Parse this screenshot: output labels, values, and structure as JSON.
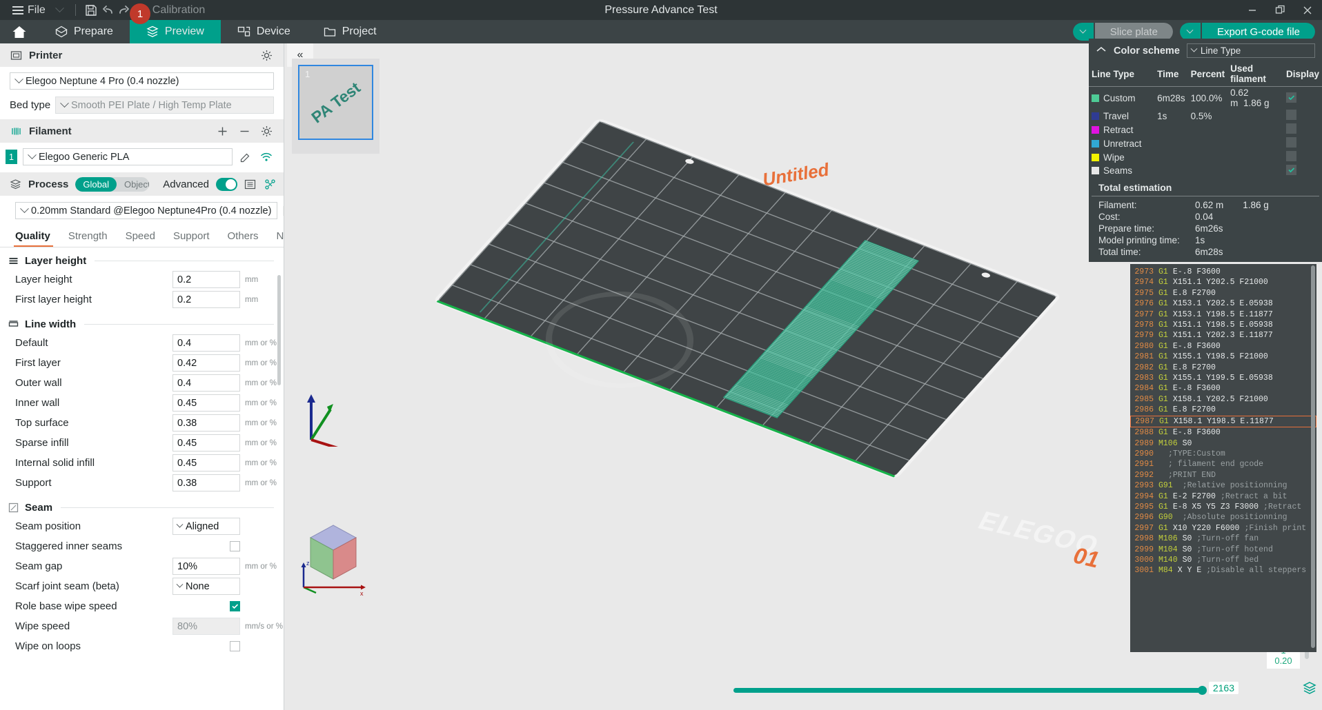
{
  "titlebar": {
    "file_label": "File",
    "calibration_label": "Calibration",
    "notification_count": "1",
    "app_title": "Pressure Advance Test",
    "icons": {
      "save": "save-icon",
      "undo": "undo-icon",
      "redo": "redo-icon",
      "calibration": "calibration-icon"
    },
    "window": {
      "minimize": "minimize-icon",
      "restore": "restore-icon",
      "close": "close-icon"
    }
  },
  "navbar": {
    "home": "home-icon",
    "tabs": [
      {
        "label": "Prepare",
        "icon": "prepare-icon",
        "active": false
      },
      {
        "label": "Preview",
        "icon": "preview-icon",
        "active": true
      },
      {
        "label": "Device",
        "icon": "device-icon",
        "active": false
      },
      {
        "label": "Project",
        "icon": "project-icon",
        "active": false
      }
    ],
    "slice_plate_label": "Slice plate",
    "export_label": "Export G-code file"
  },
  "printer": {
    "section_title": "Printer",
    "model": "Elegoo Neptune 4 Pro (0.4 nozzle)",
    "bed_type_label": "Bed type",
    "bed_type_value": "Smooth PEI Plate / High Temp Plate"
  },
  "filament": {
    "section_title": "Filament",
    "index": "1",
    "name": "Elegoo Generic PLA"
  },
  "process": {
    "section_title": "Process",
    "scope_global": "Global",
    "scope_objects": "Objects",
    "advanced_label": "Advanced",
    "preset": "0.20mm Standard @Elegoo Neptune4Pro (0.4 nozzle)",
    "tabs": [
      "Quality",
      "Strength",
      "Speed",
      "Support",
      "Others",
      "Notes"
    ],
    "active_tab": "Quality",
    "groups": [
      {
        "title": "Layer height",
        "icon": "layer-height-icon",
        "rows": [
          {
            "label": "Layer height",
            "value": "0.2",
            "unit": "mm",
            "type": "text"
          },
          {
            "label": "First layer height",
            "value": "0.2",
            "unit": "mm",
            "type": "text"
          }
        ]
      },
      {
        "title": "Line width",
        "icon": "line-width-icon",
        "rows": [
          {
            "label": "Default",
            "value": "0.4",
            "unit": "mm or %",
            "type": "text"
          },
          {
            "label": "First layer",
            "value": "0.42",
            "unit": "mm or %",
            "type": "text"
          },
          {
            "label": "Outer wall",
            "value": "0.4",
            "unit": "mm or %",
            "type": "text"
          },
          {
            "label": "Inner wall",
            "value": "0.45",
            "unit": "mm or %",
            "type": "text"
          },
          {
            "label": "Top surface",
            "value": "0.38",
            "unit": "mm or %",
            "type": "text"
          },
          {
            "label": "Sparse infill",
            "value": "0.45",
            "unit": "mm or %",
            "type": "text"
          },
          {
            "label": "Internal solid infill",
            "value": "0.45",
            "unit": "mm or %",
            "type": "text"
          },
          {
            "label": "Support",
            "value": "0.38",
            "unit": "mm or %",
            "type": "text"
          }
        ]
      },
      {
        "title": "Seam",
        "icon": "seam-icon",
        "rows": [
          {
            "label": "Seam position",
            "value": "Aligned",
            "unit": "",
            "type": "select"
          },
          {
            "label": "Staggered inner seams",
            "value": "",
            "unit": "",
            "type": "checkbox",
            "checked": false
          },
          {
            "label": "Seam gap",
            "value": "10%",
            "unit": "mm or %",
            "type": "text"
          },
          {
            "label": "Scarf joint seam (beta)",
            "value": "None",
            "unit": "",
            "type": "select"
          },
          {
            "label": "Role base wipe speed",
            "value": "",
            "unit": "",
            "type": "checkbox",
            "checked": true
          },
          {
            "label": "Wipe speed",
            "value": "80%",
            "unit": "mm/s or %",
            "type": "text",
            "disabled": true
          },
          {
            "label": "Wipe on loops",
            "value": "",
            "unit": "",
            "type": "checkbox",
            "checked": false
          }
        ]
      }
    ]
  },
  "viewport": {
    "collapse_label": "«",
    "plate_number": "1",
    "plate_thumb_label": "PA Test",
    "model_name": "Untitled",
    "plate_index_3d": "01",
    "bed_brand": "ELEGOO"
  },
  "legend": {
    "title": "Color scheme",
    "scheme_value": "Line Type",
    "columns": [
      "Line Type",
      "Time",
      "Percent",
      "Used filament",
      "Display"
    ],
    "rows": [
      {
        "name": "Custom",
        "color": "#4ecb96",
        "time": "6m28s",
        "percent": "100.0%",
        "used_len": "0.62 m",
        "used_mass": "1.86 g",
        "display": true
      },
      {
        "name": "Travel",
        "color": "#2f3b93",
        "time": "1s",
        "percent": "0.5%",
        "used_len": "",
        "used_mass": "",
        "display": false
      },
      {
        "name": "Retract",
        "color": "#e013e0",
        "time": "",
        "percent": "",
        "used_len": "",
        "used_mass": "",
        "display": false
      },
      {
        "name": "Unretract",
        "color": "#31a8d4",
        "time": "",
        "percent": "",
        "used_len": "",
        "used_mass": "",
        "display": false
      },
      {
        "name": "Wipe",
        "color": "#f2f200",
        "time": "",
        "percent": "",
        "used_len": "",
        "used_mass": "",
        "display": false
      },
      {
        "name": "Seams",
        "color": "#e8e8e8",
        "time": "",
        "percent": "",
        "used_len": "",
        "used_mass": "",
        "display": true
      }
    ],
    "estimation_title": "Total estimation",
    "estimation": [
      {
        "key": "Filament:",
        "value": "0.62 m",
        "value2": "1.86 g"
      },
      {
        "key": "Cost:",
        "value": "0.04",
        "value2": ""
      },
      {
        "key": "Prepare time:",
        "value": "6m26s",
        "value2": ""
      },
      {
        "key": "Model printing time:",
        "value": "1s",
        "value2": ""
      },
      {
        "key": "Total time:",
        "value": "6m28s",
        "value2": ""
      }
    ]
  },
  "gcode": {
    "lines": [
      {
        "n": "2973",
        "cmd": "G1",
        "arg": "E-.8 F3600",
        "cmt": ""
      },
      {
        "n": "2974",
        "cmd": "G1",
        "arg": "X151.1 Y202.5 F21000",
        "cmt": ""
      },
      {
        "n": "2975",
        "cmd": "G1",
        "arg": "E.8 F2700",
        "cmt": ""
      },
      {
        "n": "2976",
        "cmd": "G1",
        "arg": "X153.1 Y202.5 E.05938",
        "cmt": ""
      },
      {
        "n": "2977",
        "cmd": "G1",
        "arg": "X153.1 Y198.5 E.11877",
        "cmt": ""
      },
      {
        "n": "2978",
        "cmd": "G1",
        "arg": "X151.1 Y198.5 E.05938",
        "cmt": ""
      },
      {
        "n": "2979",
        "cmd": "G1",
        "arg": "X151.1 Y202.3 E.11877",
        "cmt": ""
      },
      {
        "n": "2980",
        "cmd": "G1",
        "arg": "E-.8 F3600",
        "cmt": ""
      },
      {
        "n": "2981",
        "cmd": "G1",
        "arg": "X155.1 Y198.5 F21000",
        "cmt": ""
      },
      {
        "n": "2982",
        "cmd": "G1",
        "arg": "E.8 F2700",
        "cmt": ""
      },
      {
        "n": "2983",
        "cmd": "G1",
        "arg": "X155.1 Y199.5 E.05938",
        "cmt": ""
      },
      {
        "n": "2984",
        "cmd": "G1",
        "arg": "E-.8 F3600",
        "cmt": ""
      },
      {
        "n": "2985",
        "cmd": "G1",
        "arg": "X158.1 Y202.5 F21000",
        "cmt": ""
      },
      {
        "n": "2986",
        "cmd": "G1",
        "arg": "E.8 F2700",
        "cmt": ""
      },
      {
        "n": "2987",
        "cmd": "G1",
        "arg": "X158.1 Y198.5 E.11877",
        "cmt": "",
        "highlight": true
      },
      {
        "n": "2988",
        "cmd": "G1",
        "arg": "E-.8 F3600",
        "cmt": ""
      },
      {
        "n": "2989",
        "cmd": "M106",
        "arg": "S0",
        "cmt": ""
      },
      {
        "n": "2990",
        "cmd": "",
        "arg": "",
        "cmt": ";TYPE:Custom"
      },
      {
        "n": "2991",
        "cmd": "",
        "arg": "",
        "cmt": "; filament end gcode"
      },
      {
        "n": "2992",
        "cmd": "",
        "arg": "",
        "cmt": ";PRINT END"
      },
      {
        "n": "2993",
        "cmd": "G91",
        "arg": "",
        "cmt": ";Relative positionning"
      },
      {
        "n": "2994",
        "cmd": "G1",
        "arg": "E-2 F2700",
        "cmt": ";Retract a bit"
      },
      {
        "n": "2995",
        "cmd": "G1",
        "arg": "E-8 X5 Y5 Z3 F3000",
        "cmt": ";Retract"
      },
      {
        "n": "2996",
        "cmd": "G90",
        "arg": "",
        "cmt": ";Absolute positionning"
      },
      {
        "n": "2997",
        "cmd": "G1",
        "arg": "X10 Y220 F6000",
        "cmt": ";Finish print"
      },
      {
        "n": "2998",
        "cmd": "M106",
        "arg": "S0",
        "cmt": ";Turn-off fan"
      },
      {
        "n": "2999",
        "cmd": "M104",
        "arg": "S0",
        "cmt": ";Turn-off hotend"
      },
      {
        "n": "3000",
        "cmd": "M140",
        "arg": "S0",
        "cmt": ";Turn-off bed"
      },
      {
        "n": "3001",
        "cmd": "M84",
        "arg": "X Y E",
        "cmt": ";Disable all steppers but Z"
      }
    ]
  },
  "sliders": {
    "horizontal_value": "2163",
    "vertical_top_layer": "1",
    "vertical_top_height": "0.20",
    "vertical_bottom_layer": "1",
    "vertical_bottom_height": "0.20"
  },
  "colors": {
    "accent": "#00a08b",
    "titlebar_bg": "#2d3436",
    "nav_bg": "#3c4446",
    "orange": "#e8703a",
    "badge_red": "#c0392b"
  }
}
